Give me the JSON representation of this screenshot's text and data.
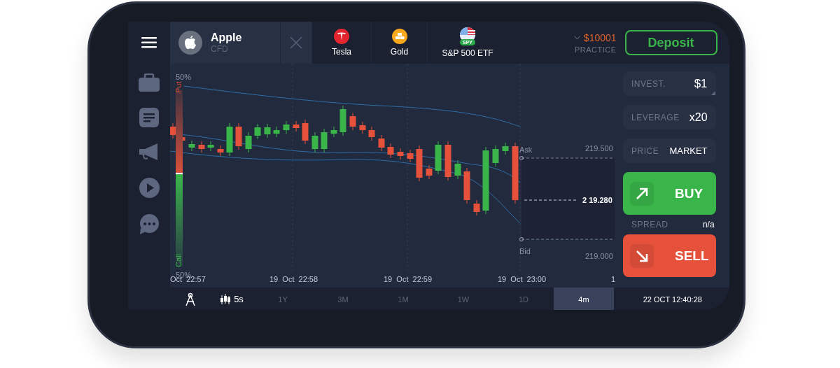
{
  "active_asset": {
    "name": "Apple",
    "type": "CFD",
    "selected": true
  },
  "tickers": [
    {
      "name": "Tesla",
      "kind": "tesla",
      "selected": false
    },
    {
      "name": "Gold",
      "kind": "gold",
      "selected": false
    },
    {
      "name": "S&P 500 ETF",
      "kind": "etf",
      "badge": "SPY",
      "selected": false
    }
  ],
  "balance": {
    "amount": "$10001",
    "mode": "PRACTICE"
  },
  "deposit_button": "Deposit",
  "chart": {
    "sentiment": {
      "top_label": "50%",
      "put_label": "Put",
      "call_label": "Call",
      "bottom_label": "50%",
      "level": 0.47
    },
    "price_labels": {
      "ask": "Ask",
      "bid": "Bid",
      "high": "219.500",
      "current": "2 19.280",
      "low": "219.000"
    },
    "time_labels": [
      "Oct  22:57",
      "19  Oct  22:58",
      "19  Oct  22:59",
      "19  Oct  23:00",
      "1"
    ]
  },
  "order": {
    "invest": {
      "label": "INVEST.",
      "value": "$1"
    },
    "leverage": {
      "label": "LEVERAGE",
      "value": "x20"
    },
    "price": {
      "label": "PRICE",
      "value": "MARKET"
    },
    "buy": "BUY",
    "spread": {
      "label": "SPREAD",
      "value": "n/a"
    },
    "sell": "SELL"
  },
  "bottom_bar": {
    "candle_interval": "5s",
    "periods": [
      {
        "label": "1Y",
        "selected": false
      },
      {
        "label": "3M",
        "selected": false
      },
      {
        "label": "1M",
        "selected": false
      },
      {
        "label": "1W",
        "selected": false
      },
      {
        "label": "1D",
        "selected": false
      },
      {
        "label": "4m",
        "selected": true
      }
    ],
    "datetime": "22 OCT 12:40:28"
  }
}
